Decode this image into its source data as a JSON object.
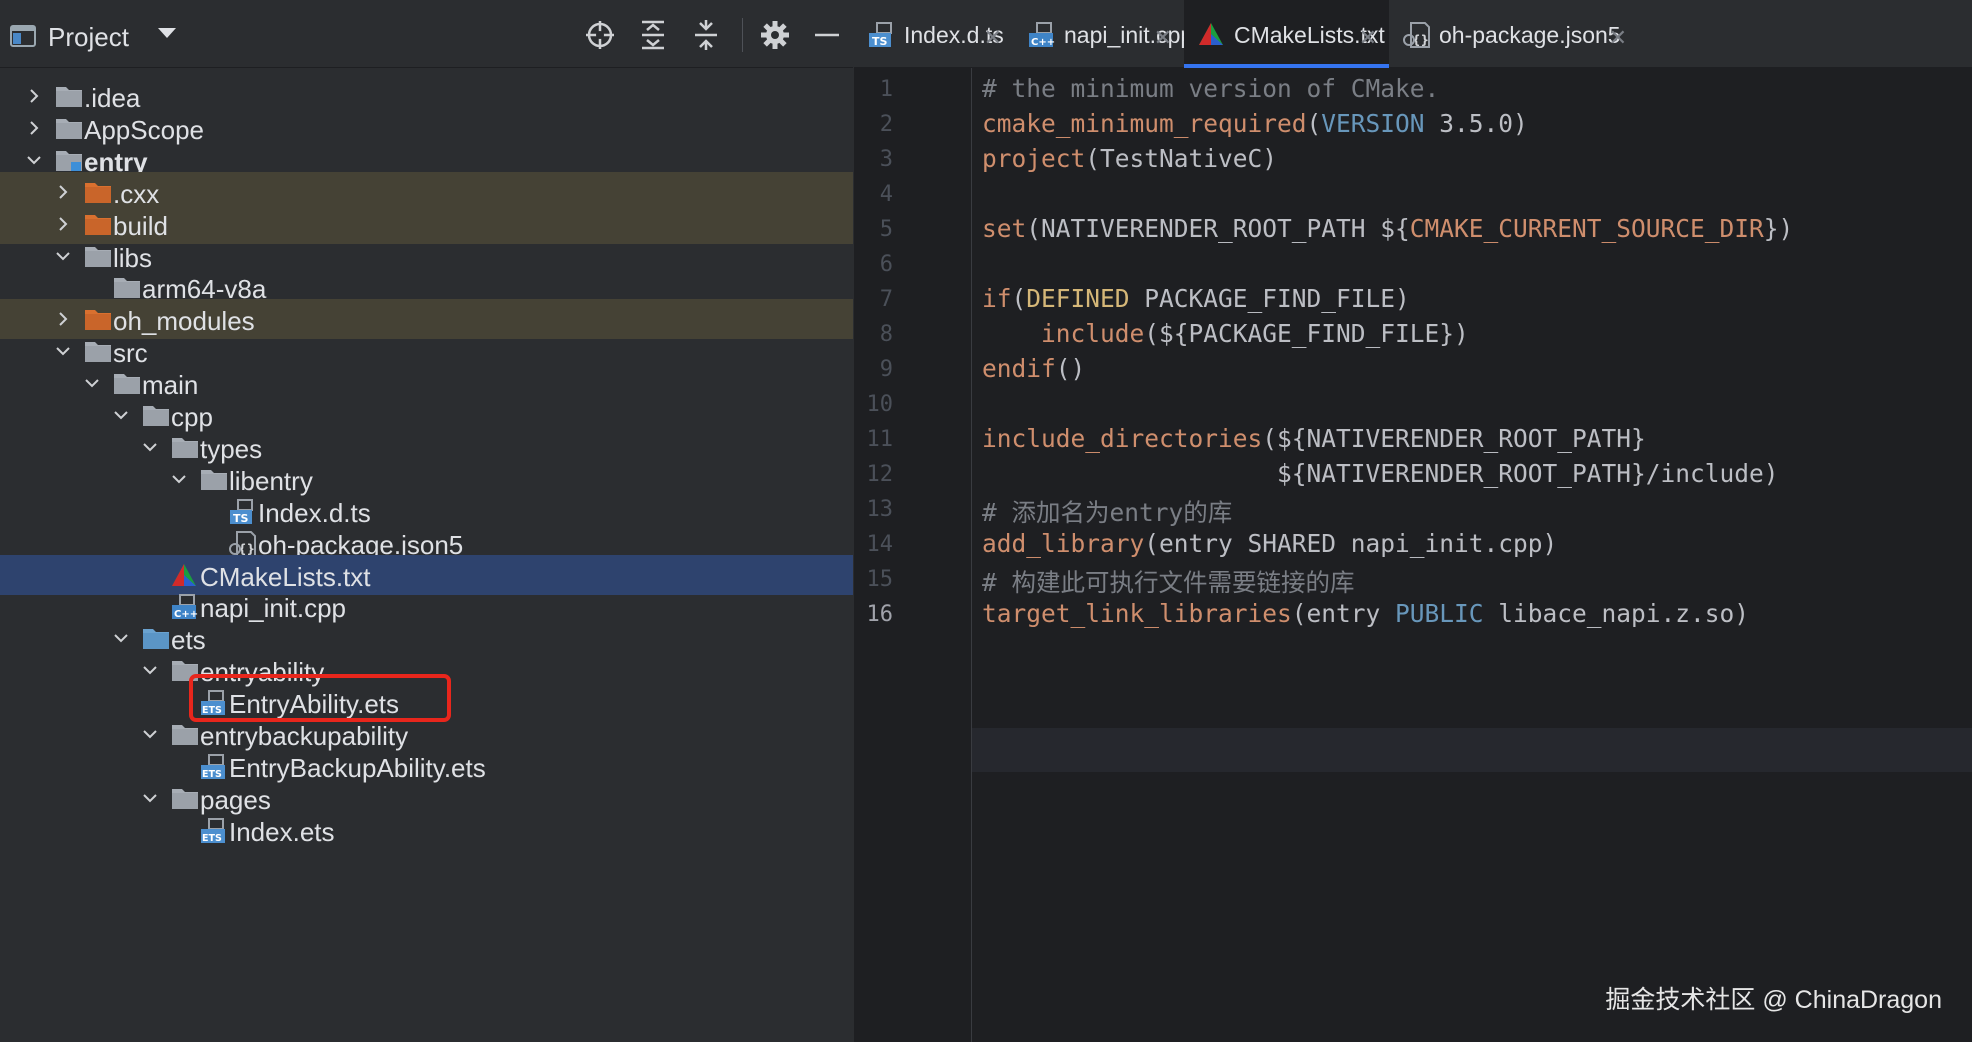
{
  "project_panel": {
    "title": "Project",
    "tree": [
      {
        "label": ".idea",
        "icon": "folder-icon",
        "expanded": false,
        "excluded": false
      },
      {
        "label": "AppScope",
        "icon": "folder-icon",
        "expanded": false,
        "excluded": false
      },
      {
        "label": "entry",
        "icon": "module-folder-icon",
        "expanded": true,
        "excluded": false
      },
      {
        "label": ".cxx",
        "icon": "excluded-folder-icon",
        "expanded": false,
        "excluded": true
      },
      {
        "label": "build",
        "icon": "excluded-folder-icon",
        "expanded": false,
        "excluded": true
      },
      {
        "label": "libs",
        "icon": "folder-icon",
        "expanded": true,
        "excluded": false
      },
      {
        "label": "arm64-v8a",
        "icon": "folder-icon",
        "expanded": null,
        "excluded": false
      },
      {
        "label": "oh_modules",
        "icon": "excluded-folder-icon",
        "expanded": false,
        "excluded": true
      },
      {
        "label": "src",
        "icon": "folder-icon",
        "expanded": true,
        "excluded": false
      },
      {
        "label": "main",
        "icon": "folder-icon",
        "expanded": true,
        "excluded": false
      },
      {
        "label": "cpp",
        "icon": "folder-icon",
        "expanded": true,
        "excluded": false
      },
      {
        "label": "types",
        "icon": "folder-icon",
        "expanded": true,
        "excluded": false
      },
      {
        "label": "libentry",
        "icon": "folder-icon",
        "expanded": true,
        "excluded": false
      },
      {
        "label": "Index.d.ts",
        "icon": "ts-file-icon",
        "expanded": null,
        "excluded": false
      },
      {
        "label": "oh-package.json5",
        "icon": "json5-file-icon",
        "expanded": null,
        "excluded": false
      },
      {
        "label": "CMakeLists.txt",
        "icon": "cmake-file-icon",
        "expanded": null,
        "excluded": false,
        "selected": true
      },
      {
        "label": "napi_init.cpp",
        "icon": "cpp-file-icon",
        "expanded": null,
        "excluded": false
      },
      {
        "label": "ets",
        "icon": "source-folder-icon",
        "expanded": true,
        "excluded": false
      },
      {
        "label": "entryability",
        "icon": "folder-icon",
        "expanded": true,
        "excluded": false
      },
      {
        "label": "EntryAbility.ets",
        "icon": "ets-file-icon",
        "expanded": null,
        "excluded": false
      },
      {
        "label": "entrybackupability",
        "icon": "folder-icon",
        "expanded": true,
        "excluded": false
      },
      {
        "label": "EntryBackupAbility.ets",
        "icon": "ets-file-icon",
        "expanded": null,
        "excluded": false
      },
      {
        "label": "pages",
        "icon": "folder-icon",
        "expanded": true,
        "excluded": false
      },
      {
        "label": "Index.ets",
        "icon": "ets-file-icon",
        "expanded": null,
        "excluded": false
      }
    ]
  },
  "tabs": [
    {
      "label": "Index.d.ts",
      "icon": "ts-file-icon",
      "active": false
    },
    {
      "label": "napi_init.cpp",
      "icon": "cpp-file-icon",
      "active": false
    },
    {
      "label": "CMakeLists.txt",
      "icon": "cmake-file-icon",
      "active": true
    },
    {
      "label": "oh-package.json5",
      "icon": "json5-file-icon",
      "active": false
    }
  ],
  "editor": {
    "current_line": 16,
    "lines": [
      [
        {
          "t": "# the minimum version of CMake.",
          "c": "t-cmt"
        }
      ],
      [
        {
          "t": "cmake_minimum_required",
          "c": "t-fn"
        },
        {
          "t": "(",
          "c": "t-plain"
        },
        {
          "t": "VERSION",
          "c": "t-kw"
        },
        {
          "t": " 3.5.0)",
          "c": "t-plain"
        }
      ],
      [
        {
          "t": "project",
          "c": "t-fn"
        },
        {
          "t": "(TestNativeC)",
          "c": "t-plain"
        }
      ],
      [],
      [
        {
          "t": "set",
          "c": "t-fn"
        },
        {
          "t": "(NATIVERENDER_ROOT_PATH ${",
          "c": "t-plain"
        },
        {
          "t": "CMAKE_CURRENT_SOURCE_DIR",
          "c": "t-var"
        },
        {
          "t": "})",
          "c": "t-plain"
        }
      ],
      [],
      [
        {
          "t": "if",
          "c": "t-fn"
        },
        {
          "t": "(",
          "c": "t-plain"
        },
        {
          "t": "DEFINED",
          "c": "t-def"
        },
        {
          "t": " PACKAGE_FIND_FILE)",
          "c": "t-plain"
        }
      ],
      [
        {
          "t": "    ",
          "c": "t-plain"
        },
        {
          "t": "include",
          "c": "t-fn"
        },
        {
          "t": "(${PACKAGE_FIND_FILE})",
          "c": "t-plain"
        }
      ],
      [
        {
          "t": "endif",
          "c": "t-fn"
        },
        {
          "t": "()",
          "c": "t-plain"
        }
      ],
      [],
      [
        {
          "t": "include_directories",
          "c": "t-fn"
        },
        {
          "t": "(${NATIVERENDER_ROOT_PATH}",
          "c": "t-plain"
        }
      ],
      [
        {
          "t": "                    ${NATIVERENDER_ROOT_PATH}/include)",
          "c": "t-plain"
        }
      ],
      [
        {
          "t": "# 添加名为entry的库",
          "c": "t-cmt"
        }
      ],
      [
        {
          "t": "add_library",
          "c": "t-fn"
        },
        {
          "t": "(entry SHARED napi_init.cpp)",
          "c": "t-plain"
        }
      ],
      [
        {
          "t": "# 构建此可执行文件需要链接的库",
          "c": "t-cmt"
        }
      ],
      [
        {
          "t": "target_link_libraries",
          "c": "t-fn"
        },
        {
          "t": "(entry ",
          "c": "t-plain"
        },
        {
          "t": "PUBLIC",
          "c": "t-pub"
        },
        {
          "t": " libace_napi.z.so)",
          "c": "t-plain"
        }
      ]
    ]
  },
  "watermark": "掘金技术社区 @ ChinaDragon",
  "colors": {
    "accent": "#3574f0",
    "selection": "#2e436e",
    "highlight_box": "#e8261c",
    "excluded_row": "#454235"
  }
}
